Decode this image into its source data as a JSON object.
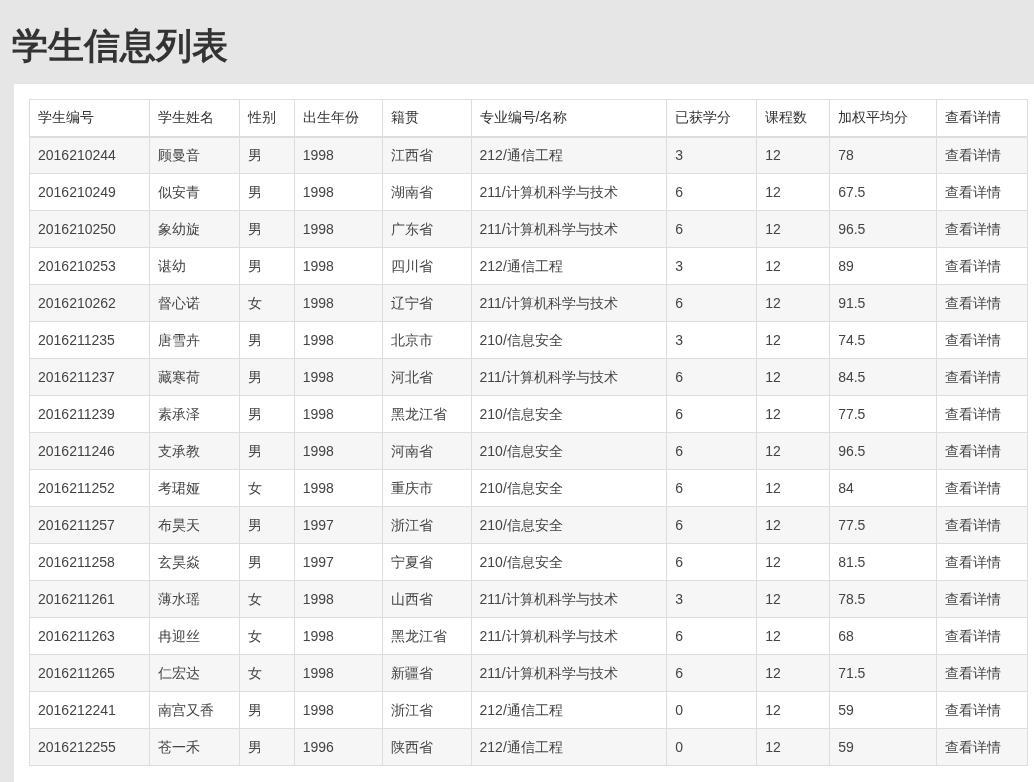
{
  "title": "学生信息列表",
  "table": {
    "columns": [
      "学生编号",
      "学生姓名",
      "性别",
      "出生年份",
      "籍贯",
      "专业编号/名称",
      "已获学分",
      "课程数",
      "加权平均分",
      "查看详情"
    ],
    "rows": [
      {
        "cells": [
          "2016210244",
          "顾曼音",
          "男",
          "1998",
          "江西省",
          "212/通信工程",
          "3",
          "12",
          "78"
        ],
        "link": "查看详情"
      },
      {
        "cells": [
          "2016210249",
          "似安青",
          "男",
          "1998",
          "湖南省",
          "211/计算机科学与技术",
          "6",
          "12",
          "67.5"
        ],
        "link": "查看详情"
      },
      {
        "cells": [
          "2016210250",
          "象幼旋",
          "男",
          "1998",
          "广东省",
          "211/计算机科学与技术",
          "6",
          "12",
          "96.5"
        ],
        "link": "查看详情"
      },
      {
        "cells": [
          "2016210253",
          "谌幼",
          "男",
          "1998",
          "四川省",
          "212/通信工程",
          "3",
          "12",
          "89"
        ],
        "link": "查看详情"
      },
      {
        "cells": [
          "2016210262",
          "督心诺",
          "女",
          "1998",
          "辽宁省",
          "211/计算机科学与技术",
          "6",
          "12",
          "91.5"
        ],
        "link": "查看详情"
      },
      {
        "cells": [
          "2016211235",
          "唐雪卉",
          "男",
          "1998",
          "北京市",
          "210/信息安全",
          "3",
          "12",
          "74.5"
        ],
        "link": "查看详情"
      },
      {
        "cells": [
          "2016211237",
          "藏寒荷",
          "男",
          "1998",
          "河北省",
          "211/计算机科学与技术",
          "6",
          "12",
          "84.5"
        ],
        "link": "查看详情"
      },
      {
        "cells": [
          "2016211239",
          "素承泽",
          "男",
          "1998",
          "黑龙江省",
          "210/信息安全",
          "6",
          "12",
          "77.5"
        ],
        "link": "查看详情"
      },
      {
        "cells": [
          "2016211246",
          "支承教",
          "男",
          "1998",
          "河南省",
          "210/信息安全",
          "6",
          "12",
          "96.5"
        ],
        "link": "查看详情"
      },
      {
        "cells": [
          "2016211252",
          "考珺娅",
          "女",
          "1998",
          "重庆市",
          "210/信息安全",
          "6",
          "12",
          "84"
        ],
        "link": "查看详情"
      },
      {
        "cells": [
          "2016211257",
          "布昊天",
          "男",
          "1997",
          "浙江省",
          "210/信息安全",
          "6",
          "12",
          "77.5"
        ],
        "link": "查看详情"
      },
      {
        "cells": [
          "2016211258",
          "玄昊焱",
          "男",
          "1997",
          "宁夏省",
          "210/信息安全",
          "6",
          "12",
          "81.5"
        ],
        "link": "查看详情"
      },
      {
        "cells": [
          "2016211261",
          "薄水瑶",
          "女",
          "1998",
          "山西省",
          "211/计算机科学与技术",
          "3",
          "12",
          "78.5"
        ],
        "link": "查看详情"
      },
      {
        "cells": [
          "2016211263",
          "冉迎丝",
          "女",
          "1998",
          "黑龙江省",
          "211/计算机科学与技术",
          "6",
          "12",
          "68"
        ],
        "link": "查看详情"
      },
      {
        "cells": [
          "2016211265",
          "仁宏达",
          "女",
          "1998",
          "新疆省",
          "211/计算机科学与技术",
          "6",
          "12",
          "71.5"
        ],
        "link": "查看详情"
      },
      {
        "cells": [
          "2016212241",
          "南宫又香",
          "男",
          "1998",
          "浙江省",
          "212/通信工程",
          "0",
          "12",
          "59"
        ],
        "link": "查看详情"
      },
      {
        "cells": [
          "2016212255",
          "苍一禾",
          "男",
          "1996",
          "陕西省",
          "212/通信工程",
          "0",
          "12",
          "59"
        ],
        "link": "查看详情"
      }
    ]
  }
}
